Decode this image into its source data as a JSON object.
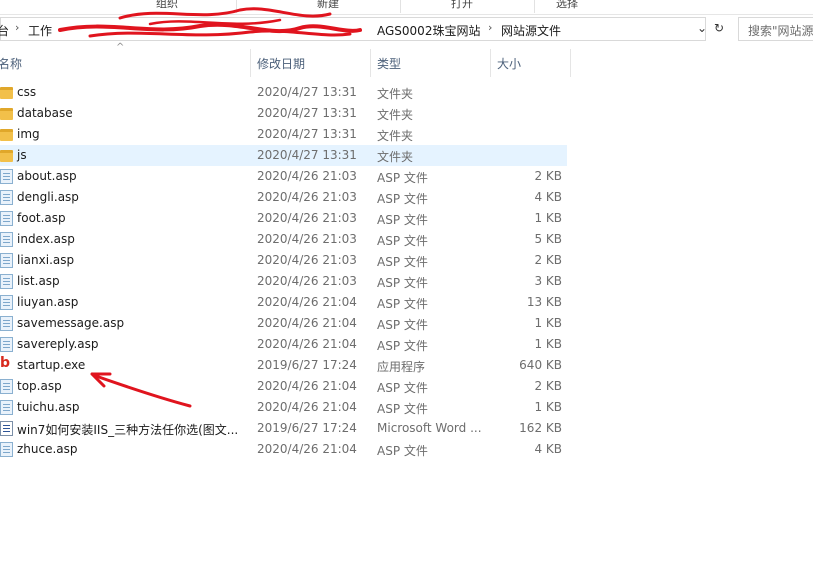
{
  "ribbon": {
    "groups": [
      "组织",
      "新建",
      "打开",
      "选择"
    ]
  },
  "addressbar": {
    "crumbs": [
      "台",
      "工作",
      "AGS0002珠宝网站",
      "网站源文件"
    ],
    "dropdown_icon": "chevron-down-icon",
    "refresh_icon": "refresh-icon"
  },
  "search": {
    "placeholder": "搜索\"网站源"
  },
  "columns": {
    "name": "名称",
    "date": "修改日期",
    "type": "类型",
    "size": "大小"
  },
  "files": [
    {
      "name": "css",
      "date": "2020/4/27 13:31",
      "type": "文件夹",
      "size": "",
      "icon": "folder-icon"
    },
    {
      "name": "database",
      "date": "2020/4/27 13:31",
      "type": "文件夹",
      "size": "",
      "icon": "folder-icon"
    },
    {
      "name": "img",
      "date": "2020/4/27 13:31",
      "type": "文件夹",
      "size": "",
      "icon": "folder-icon"
    },
    {
      "name": "js",
      "date": "2020/4/27 13:31",
      "type": "文件夹",
      "size": "",
      "icon": "folder-icon",
      "selected": true
    },
    {
      "name": "about.asp",
      "date": "2020/4/26 21:03",
      "type": "ASP 文件",
      "size": "2 KB",
      "icon": "asp-file-icon"
    },
    {
      "name": "dengli.asp",
      "date": "2020/4/26 21:03",
      "type": "ASP 文件",
      "size": "4 KB",
      "icon": "asp-file-icon"
    },
    {
      "name": "foot.asp",
      "date": "2020/4/26 21:03",
      "type": "ASP 文件",
      "size": "1 KB",
      "icon": "asp-file-icon"
    },
    {
      "name": "index.asp",
      "date": "2020/4/26 21:03",
      "type": "ASP 文件",
      "size": "5 KB",
      "icon": "asp-file-icon"
    },
    {
      "name": "lianxi.asp",
      "date": "2020/4/26 21:03",
      "type": "ASP 文件",
      "size": "2 KB",
      "icon": "asp-file-icon"
    },
    {
      "name": "list.asp",
      "date": "2020/4/26 21:03",
      "type": "ASP 文件",
      "size": "3 KB",
      "icon": "asp-file-icon"
    },
    {
      "name": "liuyan.asp",
      "date": "2020/4/26 21:04",
      "type": "ASP 文件",
      "size": "13 KB",
      "icon": "asp-file-icon"
    },
    {
      "name": "savemessage.asp",
      "date": "2020/4/26 21:04",
      "type": "ASP 文件",
      "size": "1 KB",
      "icon": "asp-file-icon"
    },
    {
      "name": "savereply.asp",
      "date": "2020/4/26 21:04",
      "type": "ASP 文件",
      "size": "1 KB",
      "icon": "asp-file-icon"
    },
    {
      "name": "startup.exe",
      "date": "2019/6/27 17:24",
      "type": "应用程序",
      "size": "640 KB",
      "icon": "exe-app-icon"
    },
    {
      "name": "top.asp",
      "date": "2020/4/26 21:04",
      "type": "ASP 文件",
      "size": "2 KB",
      "icon": "asp-file-icon"
    },
    {
      "name": "tuichu.asp",
      "date": "2020/4/26 21:04",
      "type": "ASP 文件",
      "size": "1 KB",
      "icon": "asp-file-icon"
    },
    {
      "name": "win7如何安装IIS_三种方法任你选(图文...",
      "date": "2019/6/27 17:24",
      "type": "Microsoft Word ...",
      "size": "162 KB",
      "icon": "word-doc-icon"
    },
    {
      "name": "zhuce.asp",
      "date": "2020/4/26 21:04",
      "type": "ASP 文件",
      "size": "4 KB",
      "icon": "asp-file-icon"
    }
  ],
  "colors": {
    "selection": "#e5f3ff",
    "annotation_red": "#e0141e",
    "header_text": "#4c607a",
    "muted_text": "#6d6d6d"
  }
}
